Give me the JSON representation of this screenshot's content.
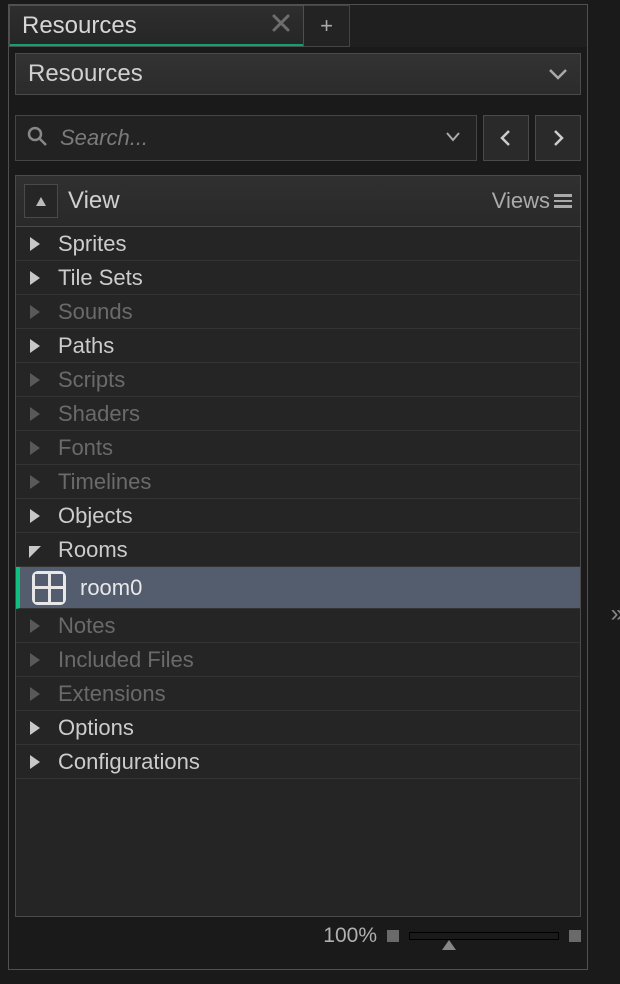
{
  "tab": {
    "label": "Resources"
  },
  "header": {
    "title": "Resources"
  },
  "search": {
    "placeholder": "Search..."
  },
  "view": {
    "label": "View",
    "menu_label": "Views"
  },
  "tree": [
    {
      "label": "Sprites",
      "expanded": false,
      "dim": false
    },
    {
      "label": "Tile Sets",
      "expanded": false,
      "dim": false
    },
    {
      "label": "Sounds",
      "expanded": false,
      "dim": true
    },
    {
      "label": "Paths",
      "expanded": false,
      "dim": false
    },
    {
      "label": "Scripts",
      "expanded": false,
      "dim": true
    },
    {
      "label": "Shaders",
      "expanded": false,
      "dim": true
    },
    {
      "label": "Fonts",
      "expanded": false,
      "dim": true
    },
    {
      "label": "Timelines",
      "expanded": false,
      "dim": true
    },
    {
      "label": "Objects",
      "expanded": false,
      "dim": false
    },
    {
      "label": "Rooms",
      "expanded": true,
      "dim": false,
      "children": [
        {
          "label": "room0",
          "type": "room",
          "selected": true
        }
      ]
    },
    {
      "label": "Notes",
      "expanded": false,
      "dim": true
    },
    {
      "label": "Included Files",
      "expanded": false,
      "dim": true
    },
    {
      "label": "Extensions",
      "expanded": false,
      "dim": true
    },
    {
      "label": "Options",
      "expanded": false,
      "dim": false
    },
    {
      "label": "Configurations",
      "expanded": false,
      "dim": false
    }
  ],
  "status": {
    "zoom_label": "100%"
  }
}
